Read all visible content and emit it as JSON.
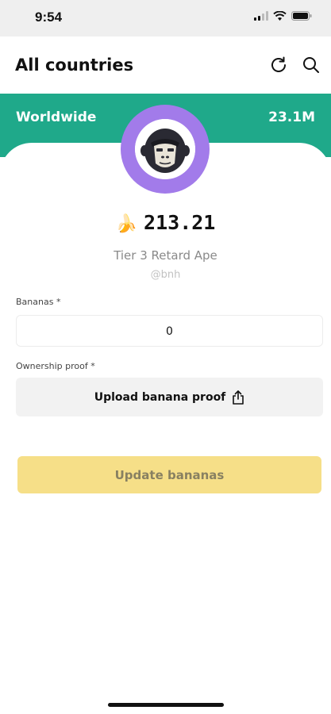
{
  "status_bar": {
    "time": "9:54"
  },
  "nav": {
    "title": "All countries",
    "refresh_icon": "refresh-icon",
    "search_icon": "search-icon"
  },
  "banner": {
    "label": "Worldwide",
    "value": "23.1M",
    "color": "#1fa98a"
  },
  "profile": {
    "avatar_icon": "gorilla-avatar",
    "ring_color": "#a27bea",
    "balance_emoji": "🍌",
    "balance": "213.21",
    "tier": "Tier 3 Retard Ape",
    "handle": "@bnh"
  },
  "form": {
    "bananas_label": "Bananas *",
    "bananas_value": "0",
    "proof_label": "Ownership proof *",
    "upload_label": "Upload banana proof",
    "submit_label": "Update bananas",
    "submit_color": "#f6df88"
  }
}
